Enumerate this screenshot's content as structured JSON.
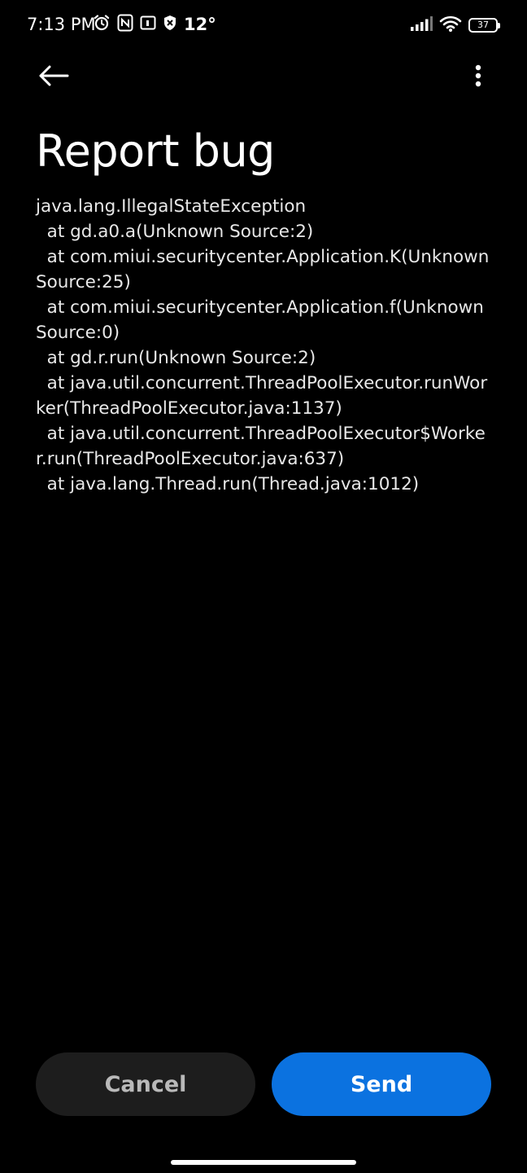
{
  "status_bar": {
    "time": "7:13 PM",
    "temperature": "12°",
    "battery": "37",
    "icons_left": [
      "alarm-icon",
      "nfc-icon",
      "calendar-icon",
      "shield-icon"
    ],
    "icons_right": [
      "signal-icon",
      "wifi-icon",
      "battery-icon"
    ]
  },
  "app_bar": {
    "back_icon": "arrow-left-icon",
    "menu_icon": "more-vertical-icon"
  },
  "page": {
    "title": "Report bug",
    "stack_trace": "java.lang.IllegalStateException\n  at gd.a0.a(Unknown Source:2)\n  at com.miui.securitycenter.Application.K(Unknown Source:25)\n  at com.miui.securitycenter.Application.f(Unknown Source:0)\n  at gd.r.run(Unknown Source:2)\n  at java.util.concurrent.ThreadPoolExecutor.runWorker(ThreadPoolExecutor.java:1137)\n  at java.util.concurrent.ThreadPoolExecutor$Worker.run(ThreadPoolExecutor.java:637)\n  at java.lang.Thread.run(Thread.java:1012)"
  },
  "actions": {
    "cancel_label": "Cancel",
    "send_label": "Send"
  },
  "colors": {
    "background": "#000000",
    "send_button": "#0b72e0",
    "cancel_button": "#1d1d1d"
  }
}
